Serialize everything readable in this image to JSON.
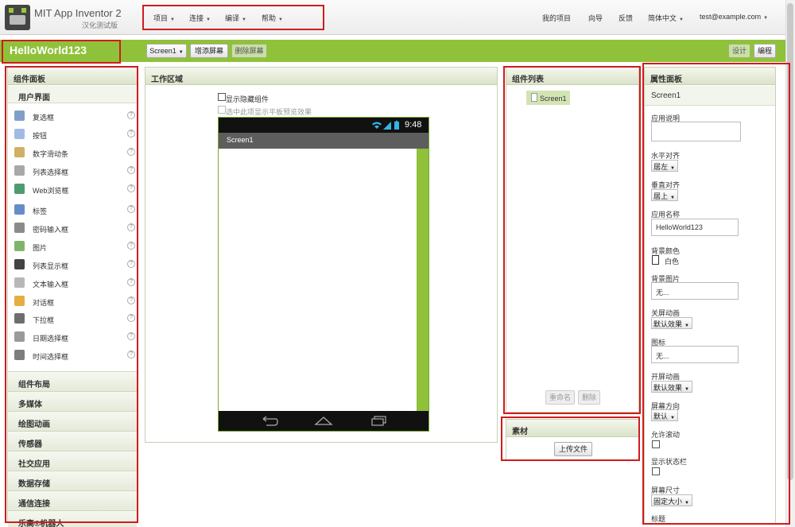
{
  "header": {
    "app_title": "MIT App Inventor 2",
    "app_subtitle": "汉化测试版",
    "menus": [
      {
        "label": "项目"
      },
      {
        "label": "连接"
      },
      {
        "label": "编译"
      },
      {
        "label": "帮助"
      }
    ],
    "right_links": {
      "my_projects": "我的项目",
      "guide": "向导",
      "feedback": "反馈",
      "language": "简体中文",
      "account": "test@example.com"
    }
  },
  "project_bar": {
    "project_name": "HelloWorld123",
    "screen_select": "Screen1",
    "add_screen": "增添屏幕",
    "remove_screen": "删除屏幕",
    "designer": "设计",
    "blocks": "编程"
  },
  "palette": {
    "title": "组件面板",
    "category_open": "用户界面",
    "items": [
      {
        "label": "复选框",
        "icon": "checkbox-icon"
      },
      {
        "label": "按钮",
        "icon": "button-icon"
      },
      {
        "label": "数字滑动条",
        "icon": "slider-icon"
      },
      {
        "label": "列表选择框",
        "icon": "listpicker-icon"
      },
      {
        "label": "Web浏览框",
        "icon": "webviewer-icon"
      },
      {
        "label": "标签",
        "icon": "label-icon"
      },
      {
        "label": "密码输入框",
        "icon": "password-icon"
      },
      {
        "label": "图片",
        "icon": "image-icon"
      },
      {
        "label": "列表显示框",
        "icon": "listview-icon"
      },
      {
        "label": "文本输入框",
        "icon": "textbox-icon"
      },
      {
        "label": "对话框",
        "icon": "notifier-icon"
      },
      {
        "label": "下拉框",
        "icon": "spinner-icon"
      },
      {
        "label": "日期选择框",
        "icon": "datepicker-icon"
      },
      {
        "label": "时间选择框",
        "icon": "timepicker-icon"
      }
    ],
    "help_glyph": "?",
    "categories": [
      "组件布局",
      "多媒体",
      "绘图动画",
      "传感器",
      "社交应用",
      "数据存储",
      "通信连接",
      "乐高®机器人"
    ]
  },
  "workspace": {
    "title": "工作区域",
    "show_hidden": "显示隐藏组件",
    "tablet_preview": "选中此项显示平板预览效果",
    "status_time": "9:48",
    "screen_title": "Screen1"
  },
  "components": {
    "title": "组件列表",
    "tree_root": "Screen1",
    "rename": "重命名",
    "delete": "删除"
  },
  "media": {
    "title": "素材",
    "upload": "上传文件"
  },
  "properties": {
    "title": "属性面板",
    "component_name": "Screen1",
    "about_label": "应用说明",
    "align_h_label": "水平对齐",
    "align_h_value": "居左",
    "align_v_label": "垂直对齐",
    "align_v_value": "居上",
    "app_name_label": "应用名称",
    "app_name_value": "HelloWorld123",
    "bg_color_label": "背景颜色",
    "bg_color_value": "白色",
    "bg_image_label": "背景图片",
    "bg_image_value": "无...",
    "close_anim_label": "关屏动画",
    "close_anim_value": "默认效果",
    "icon_label": "图标",
    "icon_value": "无...",
    "open_anim_label": "开屏动画",
    "open_anim_value": "默认效果",
    "orientation_label": "屏幕方向",
    "orientation_value": "默认",
    "scrollable_label": "允许滚动",
    "show_status_label": "显示状态栏",
    "sizing_label": "屏幕尺寸",
    "sizing_value": "固定大小",
    "title_label": "标题"
  },
  "colors": {
    "accent_green": "#8fc23a",
    "annotation_red": "#d01c1c"
  }
}
